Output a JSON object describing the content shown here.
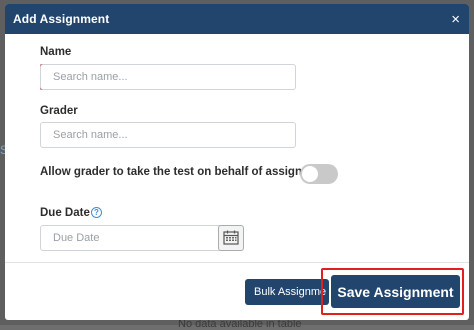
{
  "modal": {
    "title": "Add Assignment",
    "close_glyph": "×"
  },
  "form": {
    "name": {
      "label": "Name",
      "placeholder": "Search name...",
      "required": true
    },
    "grader": {
      "label": "Grader",
      "placeholder": "Search name..."
    },
    "allow_grader": {
      "label": "Allow grader to take the test on behalf of assignee",
      "enabled": false
    },
    "due_date": {
      "label": "Due Date",
      "placeholder": "Due Date",
      "help_glyph": "?"
    }
  },
  "footer": {
    "bulk_label": "Bulk Assignme",
    "save_label": "Save Assignment"
  },
  "background": {
    "partial_link": "S",
    "partial_text": "No data available in table"
  },
  "colors": {
    "header": "#22456e",
    "button": "#22456e",
    "required_marker": "#c8102e",
    "highlight_border": "#e0201f"
  },
  "icons": {
    "close": "close-icon",
    "help": "question-circle-icon",
    "calendar": "calendar-icon"
  }
}
